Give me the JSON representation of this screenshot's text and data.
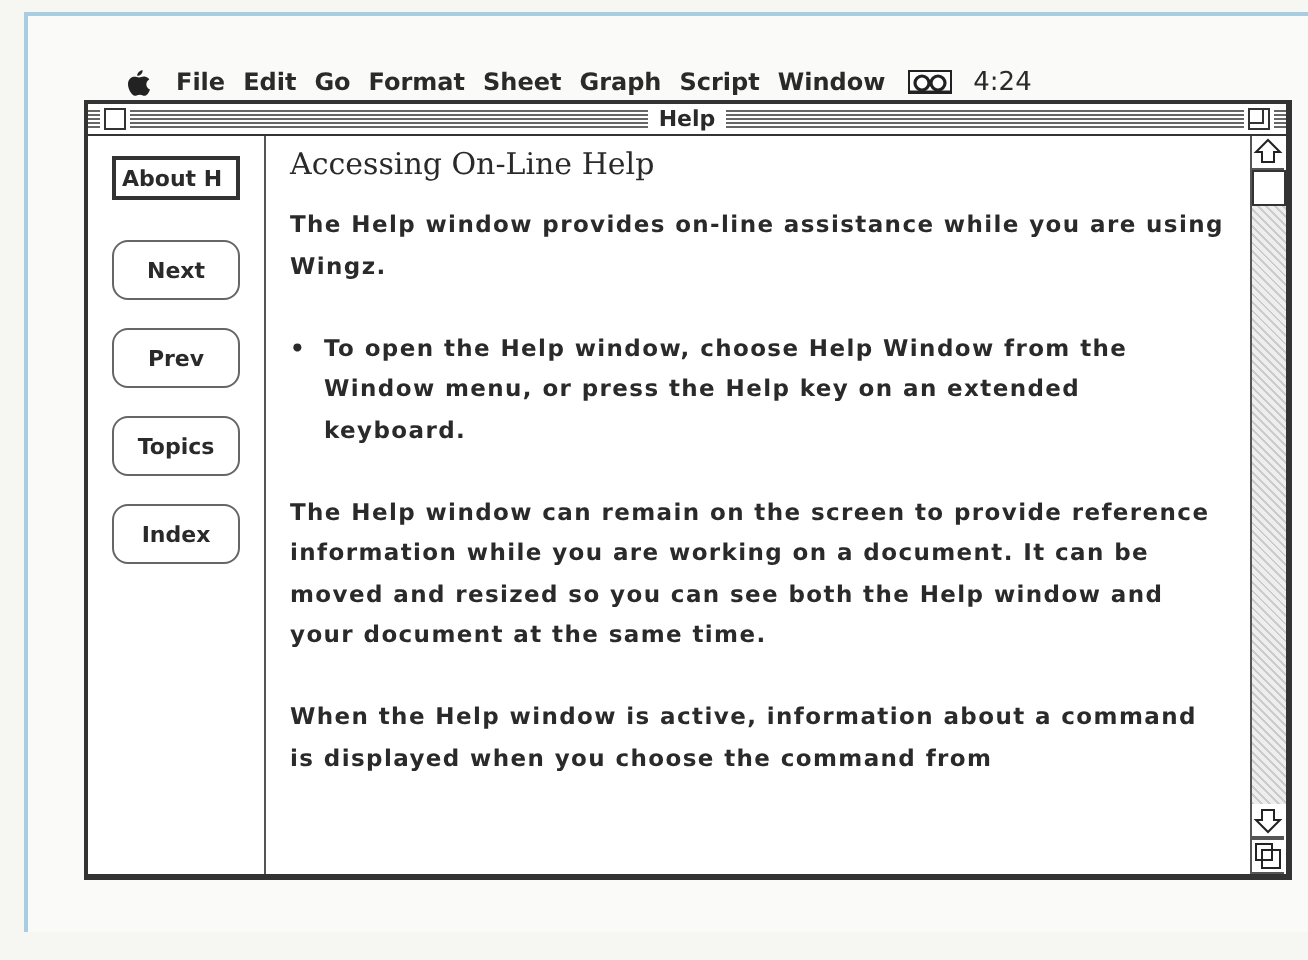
{
  "menu_bar": {
    "items": [
      "File",
      "Edit",
      "Go",
      "Format",
      "Sheet",
      "Graph",
      "Script",
      "Window"
    ],
    "clock": "4:24"
  },
  "window": {
    "title": "Help"
  },
  "nav_buttons": [
    {
      "label": "About H",
      "kind": "square"
    },
    {
      "label": "Next",
      "kind": "round"
    },
    {
      "label": "Prev",
      "kind": "round"
    },
    {
      "label": "Topics",
      "kind": "round"
    },
    {
      "label": "Index",
      "kind": "round"
    }
  ],
  "content": {
    "heading": "Accessing On-Line Help",
    "blocks": [
      {
        "kind": "text",
        "text": "The Help window provides on-line assistance while you are using Wingz."
      },
      {
        "kind": "bullet",
        "bullet": "•",
        "text": "To open the Help window, choose Help Window from the Window menu, or press the Help key on an extended keyboard."
      },
      {
        "kind": "text",
        "text": "The Help window can remain on the screen to provide reference information while you are working on a document. It can be moved and resized so you can see both the Help window and your document at the same time."
      },
      {
        "kind": "text",
        "text": "When the Help window is active, information about a command is displayed when you choose the command from"
      }
    ]
  }
}
